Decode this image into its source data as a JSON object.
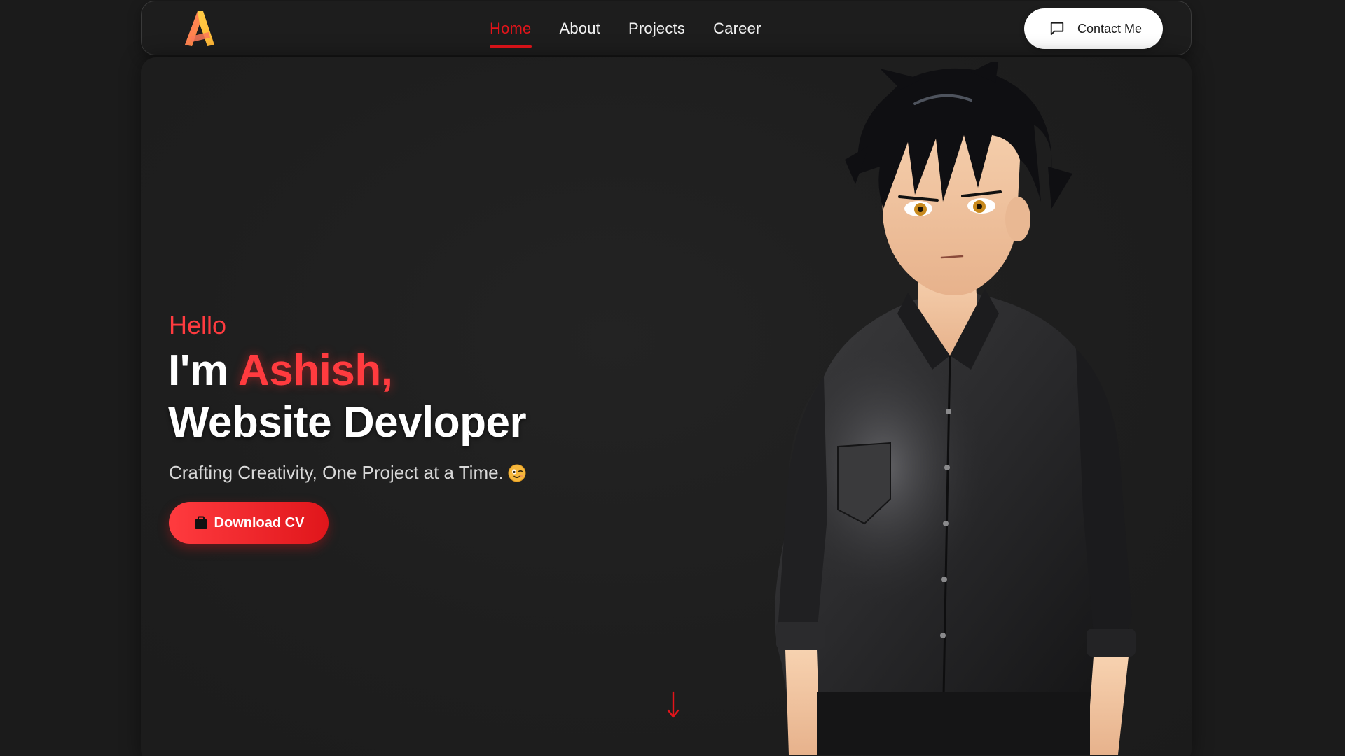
{
  "brand": {
    "logo_icon": "letter-a-logo-icon",
    "colors": {
      "accent": "#e3141a",
      "accent_light": "#ff3b3f",
      "logo_yellow": "#ffd34a",
      "logo_orange": "#ff8a3d"
    }
  },
  "nav": {
    "items": [
      {
        "label": "Home",
        "active": true
      },
      {
        "label": "About",
        "active": false
      },
      {
        "label": "Projects",
        "active": false
      },
      {
        "label": "Career",
        "active": false
      }
    ],
    "contact_label": "Contact Me",
    "contact_icon": "chat-bubble-icon"
  },
  "hero": {
    "greeting": "Hello",
    "intro_prefix": "I'm ",
    "name": "Ashish,",
    "role": "Website Devloper",
    "tagline": "Crafting Creativity, One Project at a Time.",
    "tagline_icon": "winking-face-emoji-icon",
    "cta_label": "Download CV",
    "cta_icon": "briefcase-icon",
    "scroll_icon": "arrow-down-icon",
    "portrait": "anime-style-man-in-black-shirt-illustration"
  }
}
